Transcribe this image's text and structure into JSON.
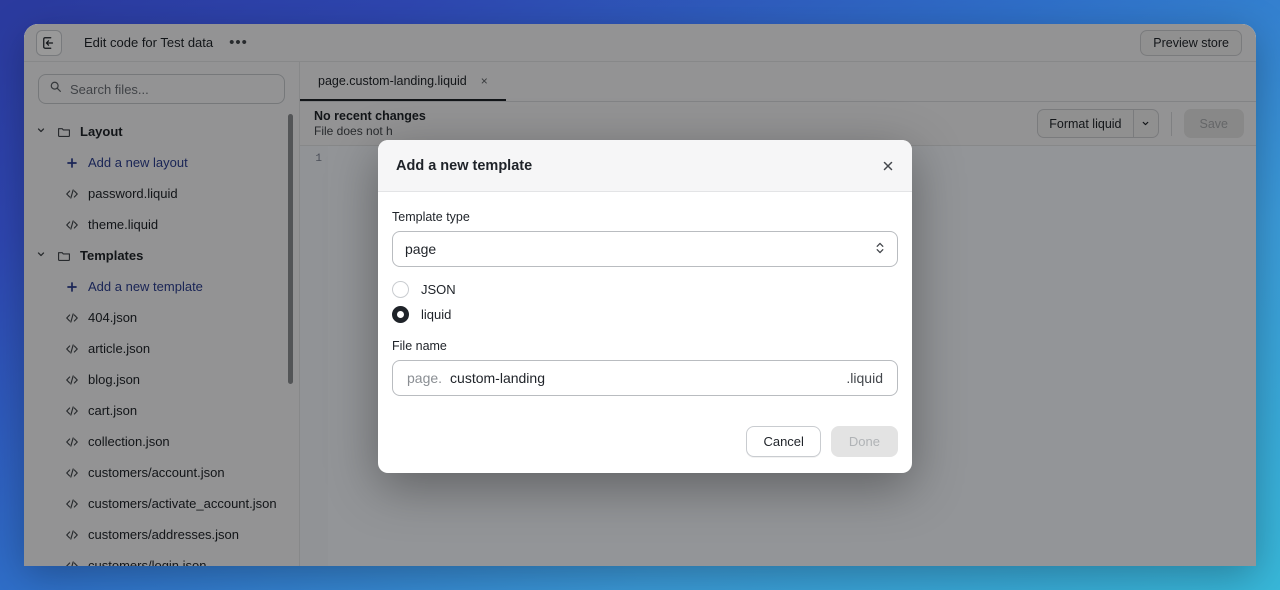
{
  "window": {
    "topbar": {
      "back_icon": "exit-icon",
      "title": "Edit code for Test data",
      "more_label": "•••",
      "preview_label": "Preview store"
    }
  },
  "sidebar": {
    "search": {
      "placeholder": "Search files...",
      "value": "",
      "icon": "search-icon"
    },
    "tree": [
      {
        "kind": "folder",
        "label": "Layout",
        "icon": "folder-icon",
        "chevron": "chevron-down-icon"
      },
      {
        "kind": "add",
        "label": "Add a new layout",
        "icon": "plus-icon"
      },
      {
        "kind": "file",
        "label": "password.liquid",
        "icon": "code-icon"
      },
      {
        "kind": "file",
        "label": "theme.liquid",
        "icon": "code-icon"
      },
      {
        "kind": "folder",
        "label": "Templates",
        "icon": "folder-icon",
        "chevron": "chevron-down-icon"
      },
      {
        "kind": "add",
        "label": "Add a new template",
        "icon": "plus-icon"
      },
      {
        "kind": "file",
        "label": "404.json",
        "icon": "code-icon"
      },
      {
        "kind": "file",
        "label": "article.json",
        "icon": "code-icon"
      },
      {
        "kind": "file",
        "label": "blog.json",
        "icon": "code-icon"
      },
      {
        "kind": "file",
        "label": "cart.json",
        "icon": "code-icon"
      },
      {
        "kind": "file",
        "label": "collection.json",
        "icon": "code-icon"
      },
      {
        "kind": "file",
        "label": "customers/account.json",
        "icon": "code-icon"
      },
      {
        "kind": "file",
        "label": "customers/activate_account.json",
        "icon": "code-icon"
      },
      {
        "kind": "file",
        "label": "customers/addresses.json",
        "icon": "code-icon"
      },
      {
        "kind": "file",
        "label": "customers/login.json",
        "icon": "code-icon"
      }
    ]
  },
  "editor": {
    "tab": {
      "label": "page.custom-landing.liquid",
      "close_label": "×"
    },
    "changes": {
      "title": "No recent changes",
      "subtitle": "File does not h"
    },
    "toolbar": {
      "format_label": "Format liquid",
      "format_caret_icon": "chevron-down-icon",
      "save_label": "Save"
    },
    "gutter_lines": [
      "1"
    ]
  },
  "modal": {
    "title": "Add a new template",
    "close_icon": "close-icon",
    "template_type": {
      "label": "Template type",
      "value": "page",
      "arrows_icon": "chevron-updown-icon"
    },
    "format_options": [
      {
        "label": "JSON",
        "checked": false
      },
      {
        "label": "liquid",
        "checked": true
      }
    ],
    "file_name": {
      "label": "File name",
      "prefix": "page.",
      "value": "custom-landing",
      "suffix": ".liquid"
    },
    "footer": {
      "cancel_label": "Cancel",
      "done_label": "Done"
    }
  },
  "colors": {
    "accent_link": "#2c3e8f",
    "panel_bg": "#f6f6f7",
    "border": "#e1e3e5",
    "text": "#1f2329",
    "muted": "#8a8e93",
    "gradient_start": "#2b3a9e",
    "gradient_end": "#38b8d9"
  }
}
